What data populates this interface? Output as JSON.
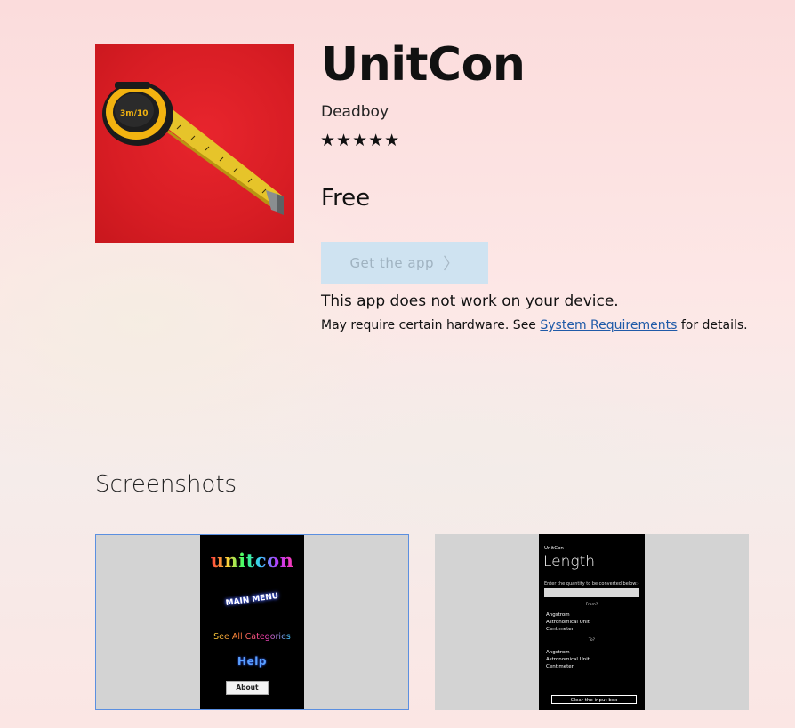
{
  "app": {
    "title": "UnitCon",
    "publisher": "Deadboy",
    "rating_stars": "★★★★★",
    "price": "Free",
    "get_button_label": "Get the app",
    "get_button_chevron": "〉",
    "incompatible_message": "This app does not work on your device.",
    "requirements_prefix": "May require certain hardware. See ",
    "requirements_link": "System Requirements",
    "requirements_suffix": " for details.",
    "icon_name": "tape-measure-icon",
    "tape_label": "3m/10"
  },
  "screenshots": {
    "section_title": "Screenshots",
    "items": [
      {
        "logo": "unitcon",
        "menu": "MAIN MENU",
        "categories": "See All Categories",
        "help": "Help",
        "about": "About"
      },
      {
        "app_name": "UnitCon",
        "page_title": "Length",
        "instruction": "Enter the quantity to be converted below:-",
        "from_label": "From?",
        "from_units": [
          "Angstrom",
          "Astronomical Unit",
          "Centimeter"
        ],
        "to_label": "To?",
        "to_units": [
          "Angstrom",
          "Astronomical Unit",
          "Centimeter"
        ],
        "clear_button": "Clear the input box"
      }
    ]
  },
  "colors": {
    "icon_background": "#d81d24",
    "button_background": "#cfe3f1",
    "link": "#1f5aa8",
    "selected_border": "#5b8fe0"
  }
}
